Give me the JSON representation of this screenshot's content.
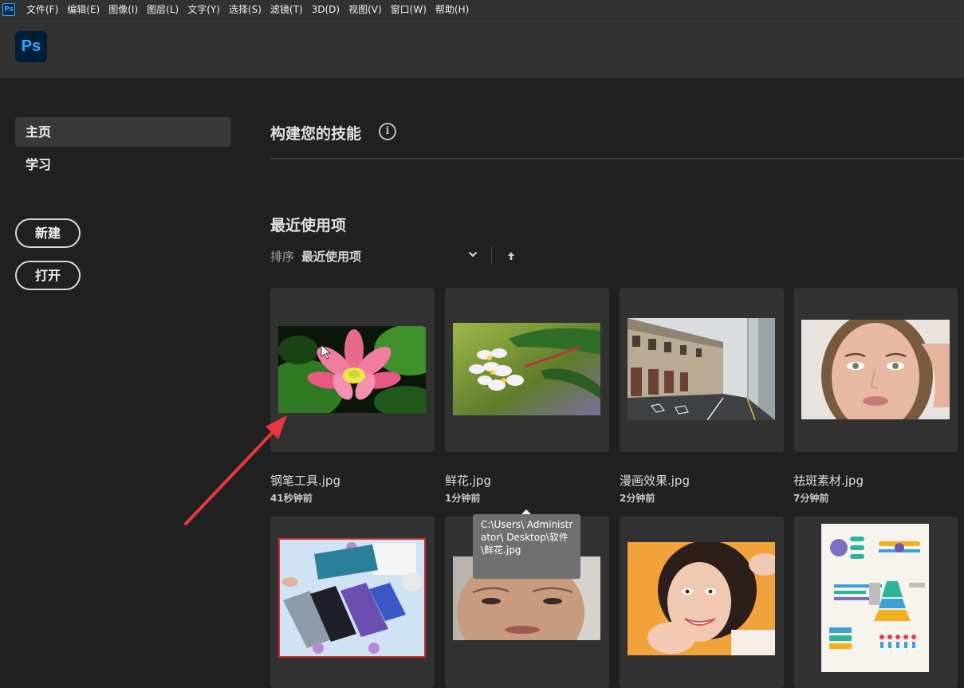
{
  "menubar": {
    "app_icon": "Ps",
    "items": [
      "文件(F)",
      "编辑(E)",
      "图像(I)",
      "图层(L)",
      "文字(Y)",
      "选择(S)",
      "滤镜(T)",
      "3D(D)",
      "视图(V)",
      "窗口(W)",
      "帮助(H)"
    ]
  },
  "header": {
    "logo": "Ps"
  },
  "sidebar": {
    "nav": [
      {
        "label": "主页",
        "active": true
      },
      {
        "label": "学习",
        "active": false
      }
    ],
    "new_button": "新建",
    "open_button": "打开"
  },
  "main": {
    "skills_title": "构建您的技能",
    "info_icon": "i",
    "recent_title": "最近使用项",
    "sort_label": "排序",
    "sort_value": "最近使用项",
    "recent_files": [
      {
        "name": "钢笔工具.jpg",
        "time": "41秒钟前"
      },
      {
        "name": "鲜花.jpg",
        "time": "1分钟前"
      },
      {
        "name": "漫画效果.jpg",
        "time": "2分钟前"
      },
      {
        "name": "祛斑素材.jpg",
        "time": "7分钟前"
      }
    ],
    "tooltip": "C:\\Users\\ Administrator\\ Desktop\\软件\\鲜花.jpg"
  },
  "colors": {
    "background": "#212121",
    "header": "#323232",
    "card": "#323232",
    "ps_blue": "#31a8ff",
    "annotation_arrow": "#e8383d"
  }
}
